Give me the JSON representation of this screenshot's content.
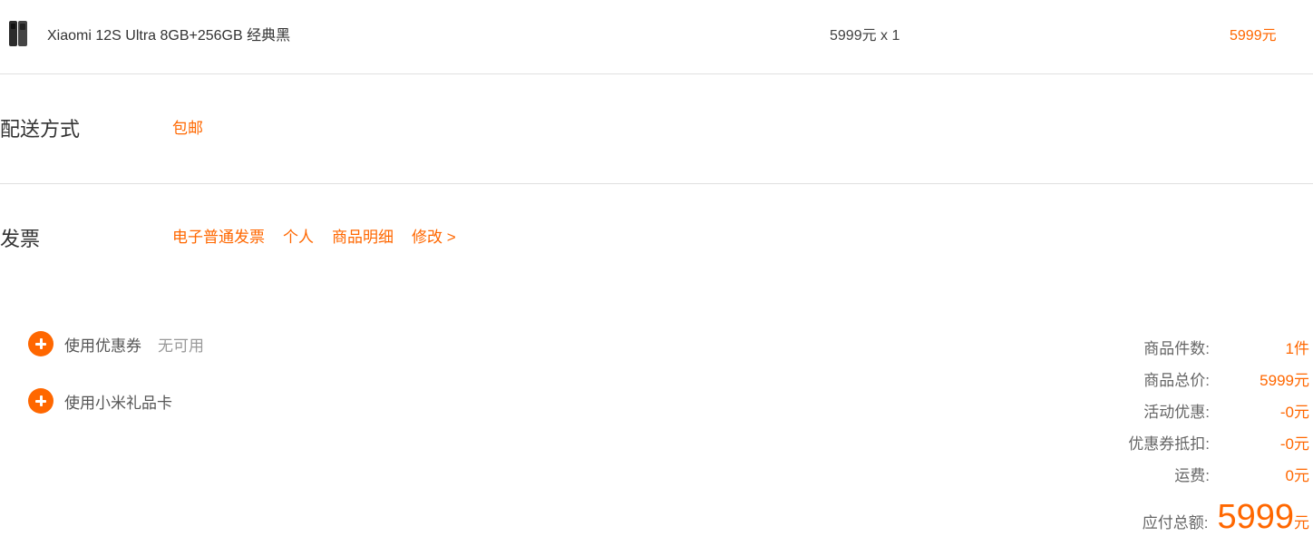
{
  "product": {
    "name": "Xiaomi 12S Ultra 8GB+256GB 经典黑",
    "unit_price": "5999元 x 1",
    "total": "5999元"
  },
  "shipping": {
    "title": "配送方式",
    "value": "包邮"
  },
  "invoice": {
    "title": "发票",
    "type": "电子普通发票",
    "holder": "个人",
    "content": "商品明细",
    "edit": "修改 >"
  },
  "perks": {
    "coupon": {
      "label": "使用优惠券",
      "status": "无可用"
    },
    "giftcard": {
      "label": "使用小米礼品卡"
    }
  },
  "summary": {
    "rows": [
      {
        "label": "商品件数:",
        "value": "1件"
      },
      {
        "label": "商品总价:",
        "value": "5999元"
      },
      {
        "label": "活动优惠:",
        "value": "-0元"
      },
      {
        "label": "优惠券抵扣:",
        "value": "-0元"
      },
      {
        "label": "运费:",
        "value": "0元"
      }
    ],
    "total_label": "应付总额:",
    "total_amount": "5999",
    "total_unit": "元"
  },
  "colors": {
    "accent": "#ff6700",
    "divider": "#e0e0e0"
  }
}
